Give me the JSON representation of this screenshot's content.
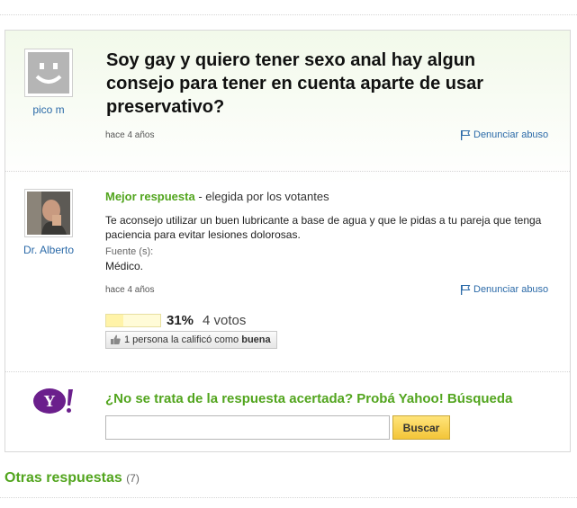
{
  "question": {
    "author": "pico m",
    "title": "Soy gay y quiero tener sexo anal hay algun consejo para tener en cuenta aparte de usar preservativo?",
    "time": "hace 4 años",
    "report_label": "Denunciar abuso",
    "avatar_icon": "default-smiley-avatar"
  },
  "best_answer": {
    "author": "Dr. Alberto",
    "label": "Mejor respuesta",
    "chosen_by": " - elegida por los votantes",
    "text": "Te aconsejo utilizar un buen lubricante a base de agua y que le pidas a tu pareja que tenga paciencia para evitar lesiones dolorosas.",
    "source_label": "Fuente (s):",
    "source_value": "Médico.",
    "time": "hace 4 años",
    "report_label": "Denunciar abuso",
    "rating": {
      "percent_text": "31%",
      "percent_value": 31,
      "votes_text": "4 votos"
    },
    "rated_prefix": "1 persona la calificó como ",
    "rated_strong": "buena"
  },
  "yahoo_promo": {
    "logo_text": "Y!",
    "text": "¿No se trata de la respuesta acertada? Probá Yahoo! Búsqueda",
    "search_value": "",
    "button_label": "Buscar"
  },
  "other_answers": {
    "label": "Otras respuestas",
    "count": "(7)"
  },
  "colors": {
    "green": "#52a51e",
    "link": "#2b6aa8",
    "yahoo_purple": "#6b1f8c"
  }
}
